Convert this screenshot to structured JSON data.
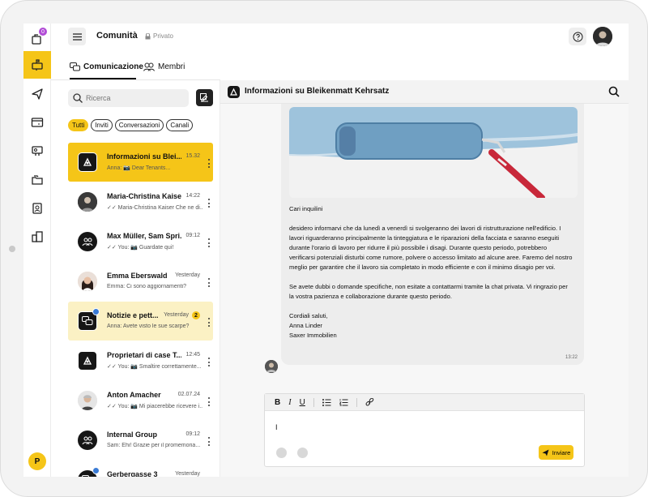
{
  "rail": {
    "notification_count": "0",
    "logo_letter": "P",
    "items": [
      "inbox-icon",
      "mailbox-icon",
      "send-icon",
      "browser-sparkle-icon",
      "presentation-icon",
      "folders-icon",
      "contacts-icon",
      "buildings-icon"
    ]
  },
  "header": {
    "title": "Comunità",
    "privacy": "Privato"
  },
  "tabs": {
    "communication": "Comunicazione",
    "members": "Membri"
  },
  "search": {
    "placeholder": "Ricerca"
  },
  "filters": [
    "Tutti",
    "Inviti",
    "Conversazioni",
    "Canali"
  ],
  "conversations": [
    {
      "name": "Informazioni su Blei...",
      "time": "15.32",
      "preview": "Anna: 📷 Dear Tenants..."
    },
    {
      "name": "Maria-Christina Kaiser",
      "time": "14:22",
      "preview": "✓✓ Maria-Christina Kaiser  Che ne di..."
    },
    {
      "name": "Max Müller, Sam Spri...",
      "time": "09:12",
      "preview": "✓✓ You: 📷 Guardate qui!"
    },
    {
      "name": "Emma Eberswald",
      "time": "Yesterday",
      "preview": "Emma: Ci sono aggiornamenti?"
    },
    {
      "name": "Notizie e pett...",
      "time": "Yesterday",
      "count": "2",
      "preview": "Anna: Avete visto le sue scarpe?"
    },
    {
      "name": "Proprietari di case T...",
      "time": "12:45",
      "preview": "✓✓ You: 📷 Smaltire correttamente..."
    },
    {
      "name": "Anton Amacher",
      "time": "02.07.24",
      "preview": "✓✓ You: 📷 Mi piacerebbe ricevere i..."
    },
    {
      "name": "Internal Group",
      "time": "09:12",
      "preview": "Sam: Ehi! Grazie per il promemoria..."
    },
    {
      "name": "Gerbergasse 3",
      "time": "Yesterday",
      "preview": ""
    }
  ],
  "chat": {
    "title": "Informazioni su Bleikenmatt Kehrsatz",
    "paragraphs": [
      "Cari inquilini",
      "desidero informarvi che da lunedì a venerdì si svolgeranno dei lavori di ristrutturazione nell'edificio. I lavori riguarderanno principalmente la tinteggiatura e le riparazioni della facciata e saranno eseguiti durante l'orario di lavoro per ridurre il più possibile i disagi. Durante questo periodo, potrebbero verificarsi potenziali disturbi come rumore, polvere o accesso limitato ad alcune aree. Faremo del nostro meglio per garantire che il lavoro sia completato in modo efficiente e con il minimo disagio per voi.",
      "Se avete dubbi o domande specifiche, non esitate a contattarmi tramite la chat privata. Vi ringrazio per la vostra pazienza e collaborazione durante questo periodo.",
      "Cordiali saluti,\nAnna Linder\nSaxer Immobilien"
    ],
    "message_time": "13:22"
  },
  "composer": {
    "bold": "B",
    "italic": "I",
    "underline": "U",
    "text": "I",
    "send_label": "Inviare"
  },
  "colors": {
    "accent": "#f5c518",
    "unread_bg": "#fbf1c4",
    "dark": "#161616"
  }
}
